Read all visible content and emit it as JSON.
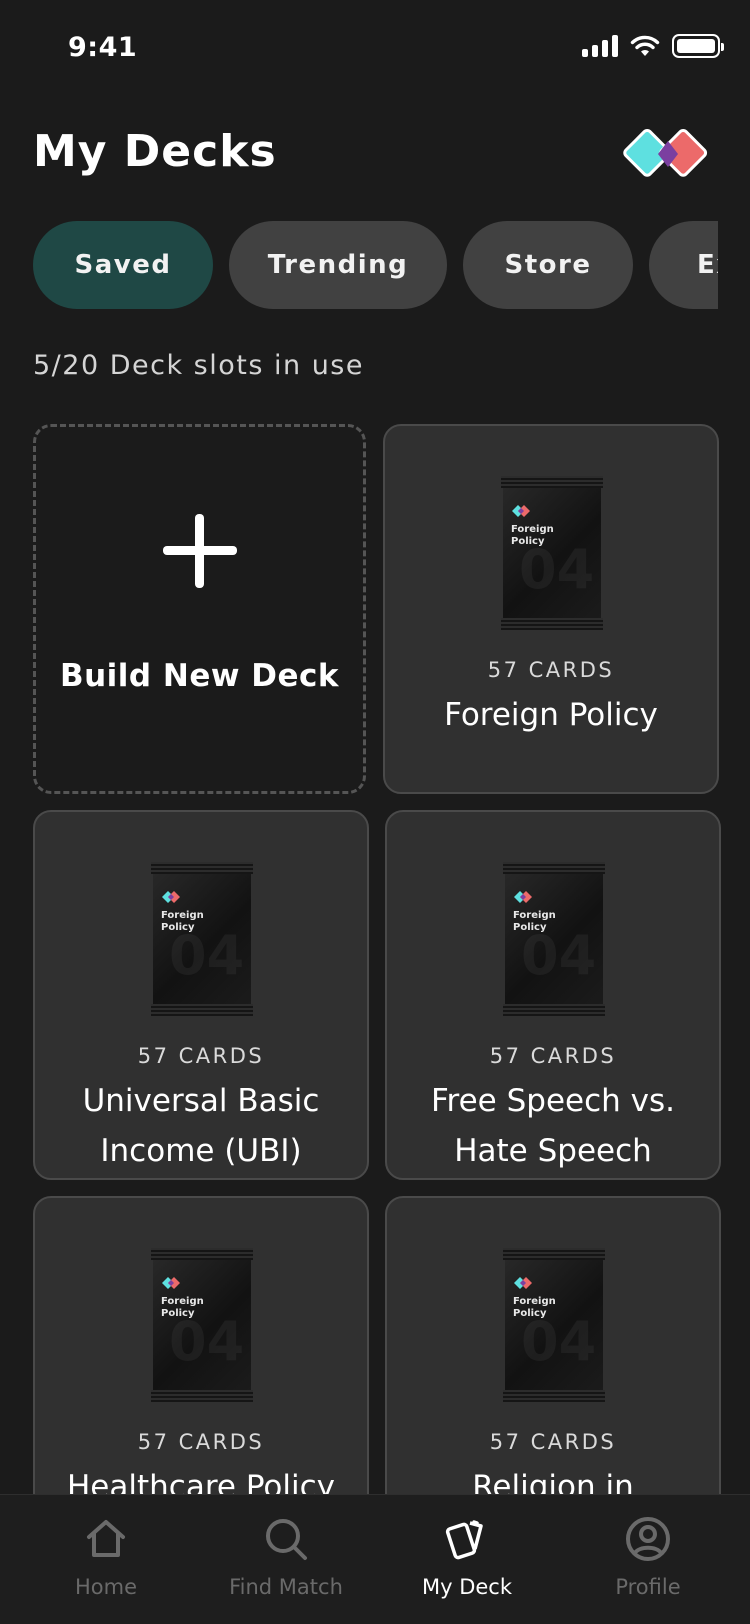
{
  "status_bar": {
    "time": "9:41"
  },
  "header": {
    "title": "My Decks",
    "logo": "app-logo-diamonds"
  },
  "tabs": [
    {
      "label": "Saved",
      "active": true
    },
    {
      "label": "Trending",
      "active": false
    },
    {
      "label": "Store",
      "active": false
    },
    {
      "label": "Ex",
      "active": false
    }
  ],
  "slots_text": "5/20 Deck slots in use",
  "new_deck": {
    "label": "Build New Deck",
    "icon": "plus-icon"
  },
  "pack": {
    "label_line1": "Foreign",
    "label_line2": "Policy",
    "number": "04"
  },
  "decks": [
    {
      "count": "57 CARDS",
      "title": "Foreign Policy"
    },
    {
      "count": "57 CARDS",
      "title": "Universal Basic Income (UBI)"
    },
    {
      "count": "57 CARDS",
      "title": "Free Speech vs. Hate Speech"
    },
    {
      "count": "57 CARDS",
      "title": "Healthcare Policy"
    },
    {
      "count": "57 CARDS",
      "title": "Religion in"
    }
  ],
  "bottom_nav": [
    {
      "label": "Home",
      "icon": "home-icon",
      "active": false
    },
    {
      "label": "Find Match",
      "icon": "search-icon",
      "active": false
    },
    {
      "label": "My Deck",
      "icon": "cards-icon",
      "active": true
    },
    {
      "label": "Profile",
      "icon": "profile-icon",
      "active": false
    }
  ],
  "colors": {
    "background": "#1b1b1b",
    "tab_active": "#1f4845",
    "tab_inactive": "#414141",
    "card": "#303030",
    "logo_cyan": "#5ee0e0",
    "logo_red": "#ec6a6a",
    "logo_purple": "#7b3fa0"
  }
}
